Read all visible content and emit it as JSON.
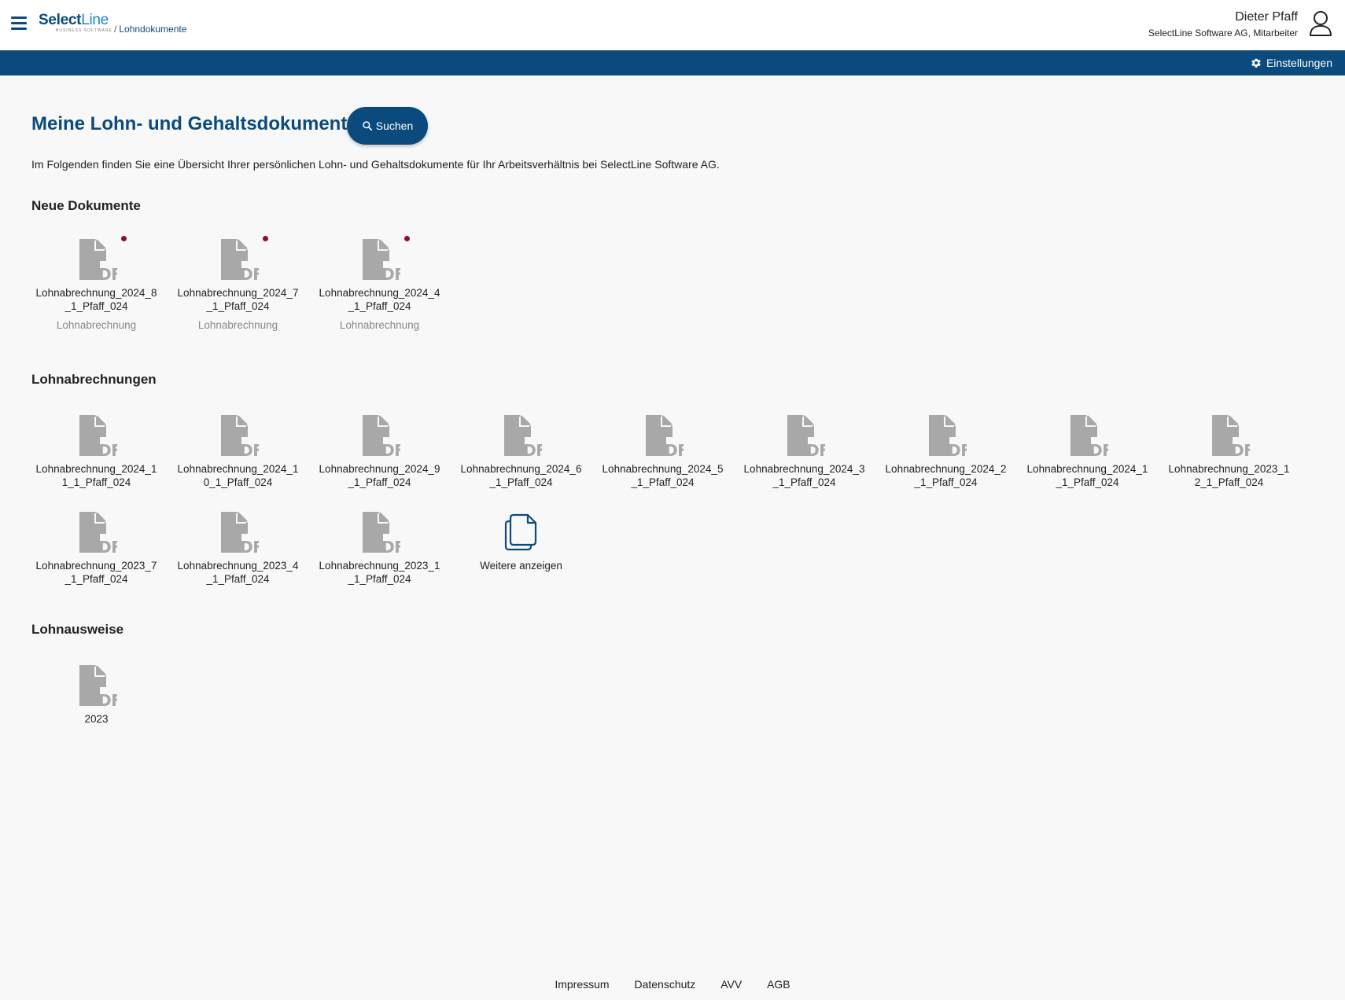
{
  "header": {
    "logo_text": "SelectLine",
    "logo_subtext": "BUSINESS SOFTWARE",
    "breadcrumb_sep": "/",
    "breadcrumb": "Lohndokumente",
    "user_name": "Dieter Pfaff",
    "user_company": "SelectLine Software AG, Mitarbeiter",
    "settings_label": "Einstellungen"
  },
  "colors": {
    "primary": "#0a4a7c",
    "new_dot": "#8b0d3a",
    "pdf_icon": "#a8a8a8",
    "background": "#f8f8f8"
  },
  "main": {
    "title": "Meine Lohn- und Gehaltsdokumente",
    "search_label": "Suchen",
    "intro": "Im Folgenden finden Sie eine Übersicht Ihrer persönlichen Lohn- und Gehaltsdokumente für Ihr Arbeitsverhältnis bei SelectLine Software AG."
  },
  "sections": {
    "new": {
      "title": "Neue Dokumente",
      "items": [
        {
          "name": "Lohnabrechnung_2024_8_1_Pfaff_024",
          "type": "Lohnabrechnung"
        },
        {
          "name": "Lohnabrechnung_2024_7_1_Pfaff_024",
          "type": "Lohnabrechnung"
        },
        {
          "name": "Lohnabrechnung_2024_4_1_Pfaff_024",
          "type": "Lohnabrechnung"
        }
      ]
    },
    "payslips": {
      "title": "Lohnabrechnungen",
      "items": [
        {
          "name": "Lohnabrechnung_2024_11_1_Pfaff_024"
        },
        {
          "name": "Lohnabrechnung_2024_10_1_Pfaff_024"
        },
        {
          "name": "Lohnabrechnung_2024_9_1_Pfaff_024"
        },
        {
          "name": "Lohnabrechnung_2024_6_1_Pfaff_024"
        },
        {
          "name": "Lohnabrechnung_2024_5_1_Pfaff_024"
        },
        {
          "name": "Lohnabrechnung_2024_3_1_Pfaff_024"
        },
        {
          "name": "Lohnabrechnung_2024_2_1_Pfaff_024"
        },
        {
          "name": "Lohnabrechnung_2024_1_1_Pfaff_024"
        },
        {
          "name": "Lohnabrechnung_2023_12_1_Pfaff_024"
        },
        {
          "name": "Lohnabrechnung_2023_7_1_Pfaff_024"
        },
        {
          "name": "Lohnabrechnung_2023_4_1_Pfaff_024"
        },
        {
          "name": "Lohnabrechnung_2023_1_1_Pfaff_024"
        }
      ],
      "more_label": "Weitere anzeigen"
    },
    "salary_certificates": {
      "title": "Lohnausweise",
      "items": [
        {
          "name": "2023"
        }
      ]
    }
  },
  "footer": {
    "links": [
      "Impressum",
      "Datenschutz",
      "AVV",
      "AGB"
    ]
  }
}
